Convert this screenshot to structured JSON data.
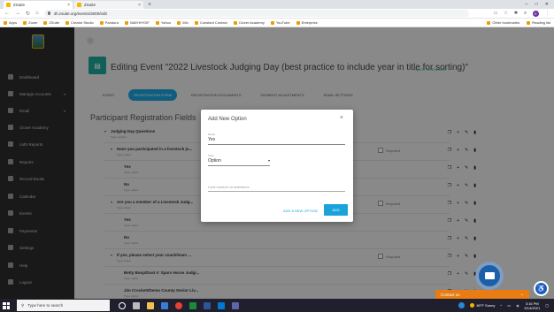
{
  "browser": {
    "tabs": [
      {
        "label": "ZSuite",
        "active": true
      },
      {
        "label": "ZSuite",
        "active": false
      }
    ],
    "new_tab": "+",
    "url": "4h.zsuite.org/events/3000/edit",
    "bookmarks": [
      "Apps",
      "Zoom",
      "ZSuite",
      "Creator Studio",
      "Pandora",
      "NAEHHYDF",
      "Yahoo",
      "Wix",
      "Constant Contact",
      "Clover Academy",
      "YouTube",
      "Enterprise"
    ],
    "other_bookmarks": "Other bookmarks",
    "reading_list": "Reading list",
    "avatar_initial": "E"
  },
  "sidebar": {
    "items": [
      {
        "label": "Dashboard",
        "icon": "grid-icon"
      },
      {
        "label": "Manage Accounts",
        "icon": "people-icon",
        "caret": "▾"
      },
      {
        "label": "Email",
        "icon": "mail-icon",
        "caret": "▾"
      },
      {
        "label": "Clover Academy",
        "icon": "academy-icon"
      },
      {
        "label": "LMS Reports",
        "icon": "reports-icon"
      },
      {
        "label": "Reports",
        "icon": "chart-icon"
      },
      {
        "label": "Record Books",
        "icon": "book-icon"
      },
      {
        "label": "Calendar",
        "icon": "calendar-icon"
      },
      {
        "label": "Events",
        "icon": "event-icon"
      },
      {
        "label": "Payments",
        "icon": "dollar-icon"
      },
      {
        "label": "Settings",
        "icon": "gear-icon"
      },
      {
        "label": "Help",
        "icon": "help-icon"
      },
      {
        "label": "Logout",
        "icon": "logout-icon"
      }
    ]
  },
  "main": {
    "event_title": "Editing Event \"2022 Livestock Judging Day (best practice to include year in title for sorting)\"",
    "back_link": "« BACK TO EVENTS",
    "tabs": [
      "EVENT",
      "REGISTRATION FORM",
      "REGISTRATION DOCUMENTS",
      "PAYMENT ADJUSTMENTS",
      "EMAIL SETTINGS"
    ],
    "section_title": "Participant Registration Fields",
    "required_label": "Required",
    "rows": [
      {
        "label": "Judging Day Questions",
        "sub": "Type: section",
        "level": 0,
        "required": false
      },
      {
        "label": "Have you participated in a livestock jo...",
        "sub": "Type: select",
        "level": 1,
        "required": true
      },
      {
        "label": "Yes",
        "sub": "Type: option",
        "level": 2,
        "required": false
      },
      {
        "label": "No",
        "sub": "Type: option",
        "level": 2,
        "required": false
      },
      {
        "label": "Are you a member of a Livestock Judg...",
        "sub": "Type: select",
        "level": 1,
        "required": true
      },
      {
        "label": "Yes",
        "sub": "Type: option",
        "level": 2,
        "required": false
      },
      {
        "label": "No",
        "sub": "Type: option",
        "level": 2,
        "required": false
      },
      {
        "label": "If yes, please select your coach/team ...",
        "sub": "Type: select",
        "level": 1,
        "required": true
      },
      {
        "label": "Betty Boop/Dust n' Spurs Horse Judgi...",
        "sub": "Type: option",
        "level": 2,
        "required": false
      },
      {
        "label": "Jim Crockett/Demo County Senior Liv...",
        "sub": "Type: option",
        "level": 2,
        "required": false
      }
    ]
  },
  "modal": {
    "title": "Add New Option",
    "close": "×",
    "name_label": "Name",
    "name_value": "Yes",
    "type_label": "Type",
    "type_value": "Option",
    "limit_placeholder": "Limit number of selections",
    "add_new_option": "ADD A NEW OPTION",
    "add": "ADD"
  },
  "widgets": {
    "contact_label": "Contact us"
  },
  "taskbar": {
    "search_placeholder": "Type here to search",
    "weather": "80°F  Sunny",
    "time": "3:16 PM",
    "date": "9/14/2021"
  }
}
